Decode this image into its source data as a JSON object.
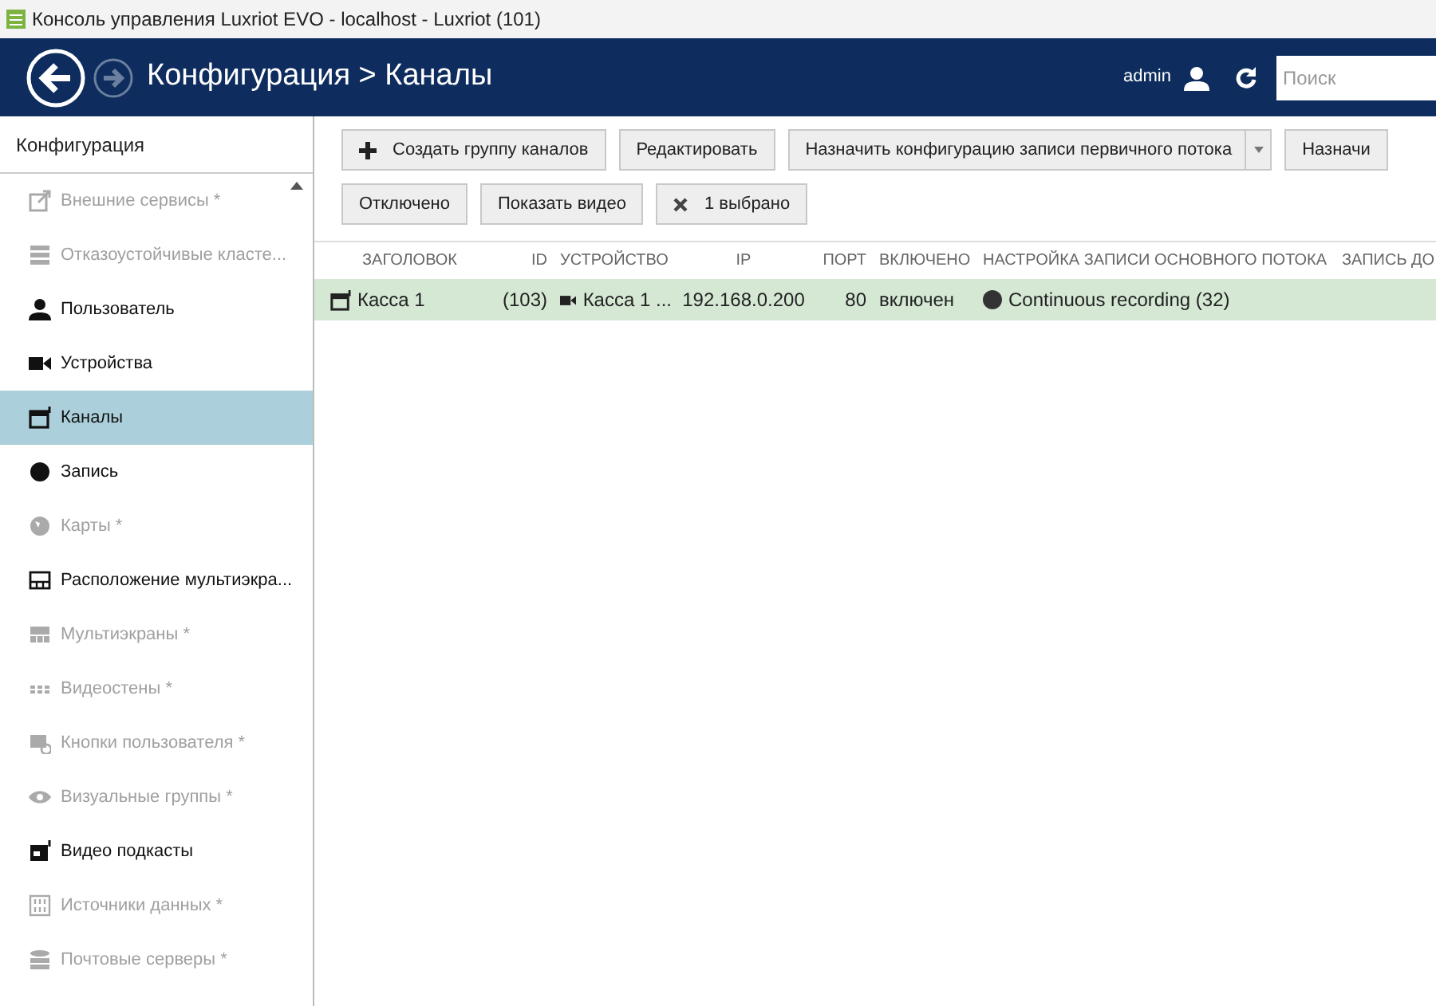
{
  "window": {
    "title": "Консоль управления Luxriot EVO - localhost - Luxriot (101)"
  },
  "header": {
    "breadcrumb": "Конфигурация > Каналы",
    "user": "admin",
    "search": {
      "placeholder": "Поиск"
    }
  },
  "sidebar": {
    "title": "Конфигурация",
    "items": [
      {
        "kind": "external",
        "label": "Внешние сервисы *",
        "disabled": true,
        "selected": false
      },
      {
        "kind": "cluster",
        "label": "Отказоустойчивые класте...",
        "disabled": true,
        "selected": false
      },
      {
        "kind": "user",
        "label": "Пользователь",
        "disabled": false,
        "selected": false
      },
      {
        "kind": "camera",
        "label": "Устройства",
        "disabled": false,
        "selected": false
      },
      {
        "kind": "channel",
        "label": "Каналы",
        "disabled": false,
        "selected": true
      },
      {
        "kind": "record",
        "label": "Запись",
        "disabled": false,
        "selected": false
      },
      {
        "kind": "globe",
        "label": "Карты *",
        "disabled": true,
        "selected": false
      },
      {
        "kind": "layout",
        "label": "Расположение мультиэкра...",
        "disabled": false,
        "selected": false
      },
      {
        "kind": "multiscreen",
        "label": "Мультиэкраны *",
        "disabled": true,
        "selected": false
      },
      {
        "kind": "wall",
        "label": "Видеостены *",
        "disabled": true,
        "selected": false
      },
      {
        "kind": "buttons",
        "label": "Кнопки пользователя *",
        "disabled": true,
        "selected": false
      },
      {
        "kind": "eye",
        "label": "Визуальные группы *",
        "disabled": true,
        "selected": false
      },
      {
        "kind": "podcast",
        "label": "Видео подкасты",
        "disabled": false,
        "selected": false
      },
      {
        "kind": "datasource",
        "label": "Источники данных *",
        "disabled": true,
        "selected": false
      },
      {
        "kind": "mail",
        "label": "Почтовые серверы *",
        "disabled": true,
        "selected": false
      }
    ]
  },
  "toolbar": {
    "actions": [
      {
        "kind": "plus",
        "label": "Создать группу каналов"
      },
      {
        "kind": "plain",
        "label": "Редактировать"
      },
      {
        "kind": "split",
        "label": "Назначить конфигурацию записи первичного потока"
      },
      {
        "kind": "plain",
        "label": "Назначи"
      }
    ],
    "filters": [
      {
        "kind": "plain",
        "label": "Отключено"
      },
      {
        "kind": "plain",
        "label": "Показать видео"
      },
      {
        "kind": "clear",
        "label": "1 выбрано"
      }
    ]
  },
  "table": {
    "columns": [
      "ЗАГОЛОВОК",
      "ID",
      "УСТРОЙСТВО",
      "IP",
      "ПОРТ",
      "ВКЛЮЧЕНО",
      "НАСТРОЙКА ЗАПИСИ ОСНОВНОГО ПОТОКА",
      "ЗАПИСЬ ДО"
    ],
    "rows": [
      {
        "selected": true,
        "cells": [
          "Касса 1",
          "(103)",
          "Касса 1 ...",
          "192.168.0.200",
          "80",
          "включен",
          "Continuous recording (32)",
          ""
        ]
      }
    ]
  }
}
